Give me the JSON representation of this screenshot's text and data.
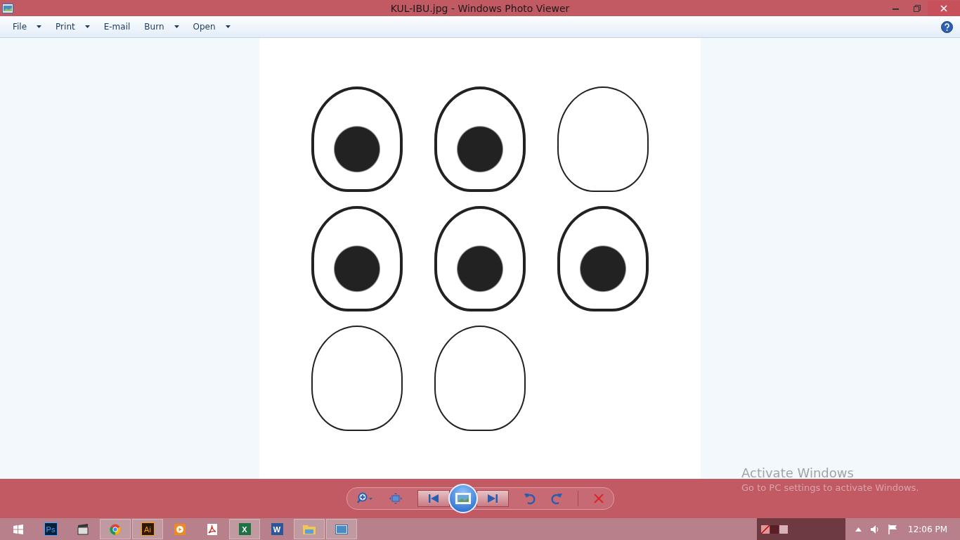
{
  "window": {
    "title": "KUL-IBU.jpg - Windows Photo Viewer"
  },
  "menu": [
    {
      "label": "File",
      "dropdown": true
    },
    {
      "label": "Print",
      "dropdown": true
    },
    {
      "label": "E-mail",
      "dropdown": false
    },
    {
      "label": "Burn",
      "dropdown": true
    },
    {
      "label": "Open",
      "dropdown": true
    }
  ],
  "activation": {
    "title": "Activate Windows",
    "message": "Go to PC settings to activate Windows."
  },
  "taskbar": {
    "items": [
      {
        "kind": "photoshop",
        "label": "Ps",
        "running": false
      },
      {
        "kind": "media",
        "running": false
      },
      {
        "kind": "chrome",
        "running": true
      },
      {
        "kind": "illustrator",
        "label": "Ai",
        "running": true
      },
      {
        "kind": "player",
        "running": false
      },
      {
        "kind": "pdf",
        "running": false
      },
      {
        "kind": "excel",
        "label": "X",
        "running": true
      },
      {
        "kind": "word",
        "label": "W",
        "running": false
      },
      {
        "kind": "folder",
        "running": true
      },
      {
        "kind": "photo",
        "running": true
      }
    ],
    "clock": "12:06 PM"
  }
}
